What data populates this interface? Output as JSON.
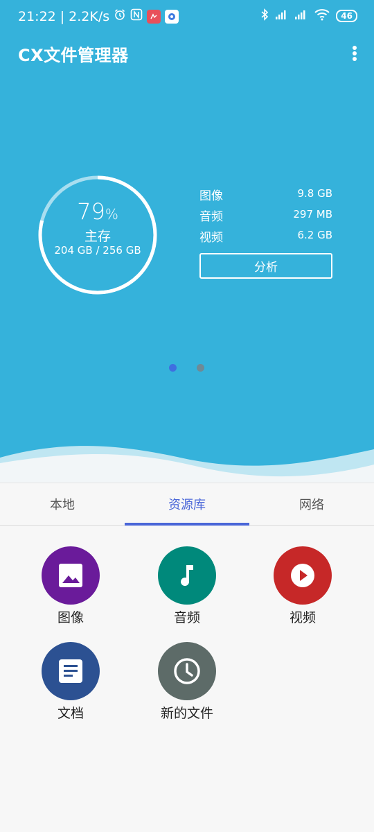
{
  "status": {
    "time": "21:22",
    "speed": "2.2K/s",
    "battery": "46"
  },
  "app": {
    "title": "CX文件管理器"
  },
  "storage": {
    "percent": "79",
    "percent_sign": "%",
    "usage_fraction": 0.79,
    "label": "主存",
    "capacity": "204 GB / 256 GB"
  },
  "stats": [
    {
      "label": "图像",
      "value": "9.8 GB"
    },
    {
      "label": "音频",
      "value": "297 MB"
    },
    {
      "label": "视频",
      "value": "6.2 GB"
    }
  ],
  "analyze_label": "分析",
  "pager": {
    "current": 1,
    "total": 2
  },
  "tabs": [
    {
      "label": "本地"
    },
    {
      "label": "资源库"
    },
    {
      "label": "网络"
    }
  ],
  "categories": [
    {
      "label": "图像",
      "icon": "image-icon",
      "color": "#6a1b9a"
    },
    {
      "label": "音频",
      "icon": "music-note-icon",
      "color": "#00897b"
    },
    {
      "label": "视频",
      "icon": "play-icon",
      "color": "#c62828"
    },
    {
      "label": "文档",
      "icon": "document-icon",
      "color": "#2c5192"
    },
    {
      "label": "新的文件",
      "icon": "clock-icon",
      "color": "#5d6b68"
    }
  ],
  "colors": {
    "hero": "#35b2db",
    "accent": "#4a66d8"
  }
}
